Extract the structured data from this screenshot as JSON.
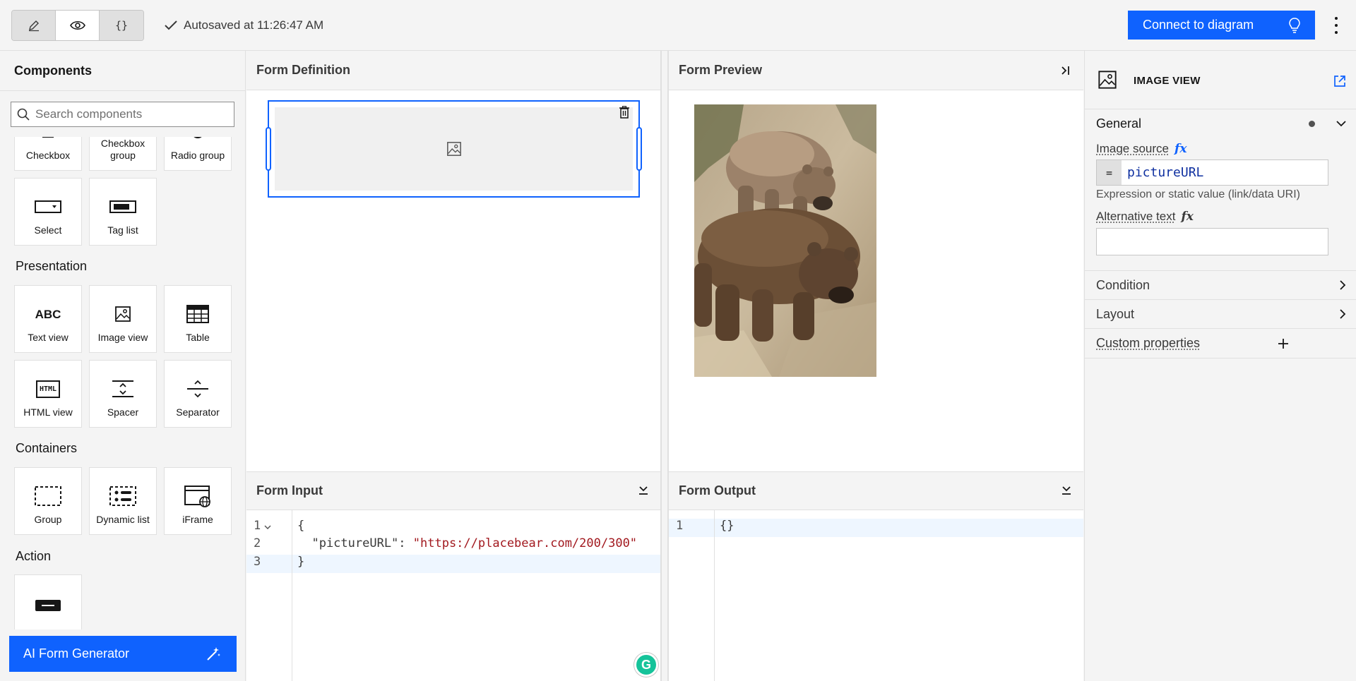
{
  "toolbar": {
    "modes": [
      {
        "name": "edit-mode",
        "label": "✎"
      },
      {
        "name": "preview-mode",
        "label": "◉"
      },
      {
        "name": "json-mode",
        "label": "{}"
      }
    ],
    "autosave_text": "Autosaved at 11:26:47 AM",
    "connect_label": "Connect to diagram"
  },
  "components": {
    "title": "Components",
    "search_placeholder": "Search components",
    "row0": [
      "Checkbox",
      "Checkbox group",
      "Radio group"
    ],
    "row1": [
      "Select",
      "Tag list"
    ],
    "groups": {
      "presentation": "Presentation",
      "containers": "Containers",
      "action": "Action"
    },
    "presentation": [
      "Text view",
      "Image view",
      "Table",
      "HTML view",
      "Spacer",
      "Separator"
    ],
    "containers": [
      "Group",
      "Dynamic list",
      "iFrame"
    ],
    "abc_glyph": "ABC",
    "html_glyph": "HTML",
    "ai_button": "AI Form Generator"
  },
  "definition": {
    "title": "Form Definition"
  },
  "preview": {
    "title": "Form Preview"
  },
  "input": {
    "title": "Form Input",
    "lines": [
      "1",
      "2",
      "3"
    ],
    "code": [
      "{",
      "  \"pictureURL\": ",
      "}"
    ],
    "url_string": "\"https://placebear.com/200/300\""
  },
  "output": {
    "title": "Form Output",
    "lines": [
      "1"
    ],
    "code": [
      "{}"
    ]
  },
  "properties": {
    "title": "IMAGE VIEW",
    "general": "General",
    "image_source_label": "Image source",
    "fx": "fx",
    "eq": "=",
    "image_source_value": "pictureURL",
    "image_source_hint": "Expression or static value (link/data URI)",
    "alt_text_label": "Alternative text",
    "condition": "Condition",
    "layout": "Layout",
    "custom_properties": "Custom properties"
  },
  "colors": {
    "accent": "#0f62fe",
    "panel_bg": "#f4f4f4",
    "border": "#e0e0e0",
    "string_red": "#a2191f"
  }
}
